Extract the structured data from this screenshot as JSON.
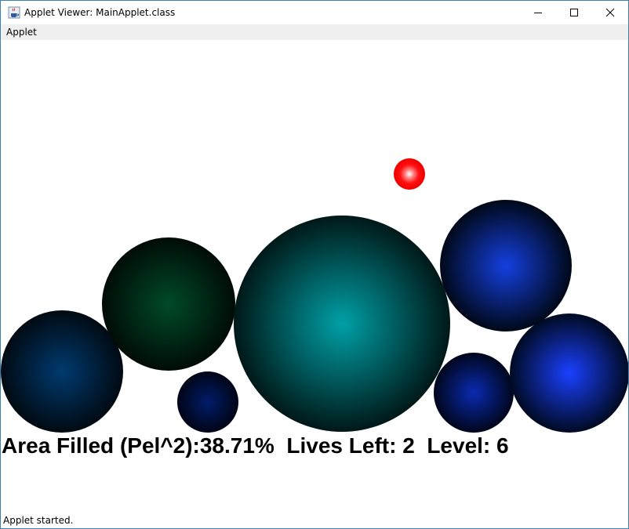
{
  "window": {
    "title": "Applet Viewer: MainApplet.class",
    "icon": "java-cup-icon",
    "controls": [
      "minimize-icon",
      "maximize-icon",
      "close-icon"
    ]
  },
  "menubar": {
    "items": [
      {
        "label": "Applet"
      }
    ]
  },
  "hud": {
    "text": "Area Filled (Pel^2):38.71%  Lives Left: 2  Level: 6"
  },
  "statusbar": {
    "text": "Applet started."
  },
  "colors": {
    "window_border": "#3c7fb1",
    "menubar_bg": "#f0f0f0",
    "ball": "#ff0000",
    "bubble_teal": "#009aa0",
    "bubble_blue": "#1a3cff",
    "bubble_navy": "#00208a",
    "bubble_green": "#00502a"
  }
}
